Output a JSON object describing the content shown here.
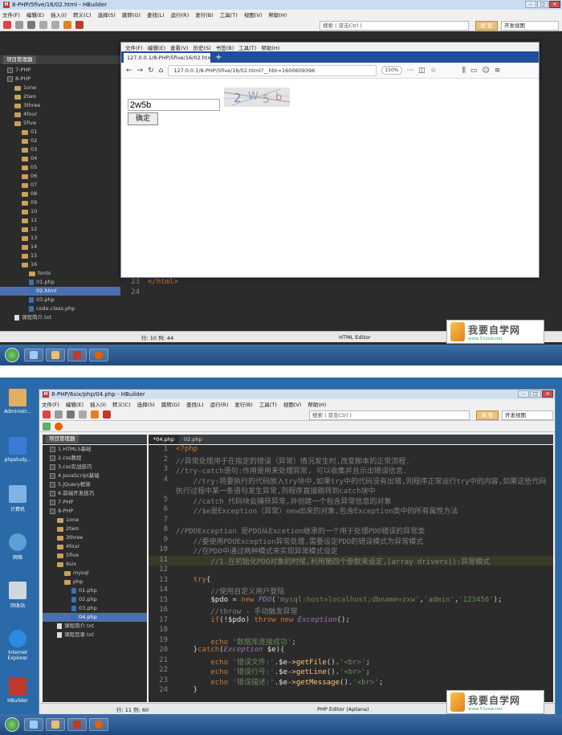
{
  "shot1": {
    "title": "8-PHP/5five/16/02.html - HBuilder",
    "menu": [
      "文件(F)",
      "编辑(E)",
      "插入(I)",
      "转义(C)",
      "选择(S)",
      "跳转(G)",
      "查找(L)",
      "运行(R)",
      "发行(B)",
      "工具(T)",
      "视图(V)",
      "帮助(H)"
    ],
    "search_placeholder": "搜索 ( 双击Ctrl )",
    "vip_label": "闻 智",
    "view_label": "开发视图",
    "panel_title": "项目管理器",
    "tree": [
      {
        "label": "7-PHP",
        "icon": "w",
        "indent": 1
      },
      {
        "label": "8-PHP",
        "icon": "w",
        "indent": 1
      },
      {
        "label": "1one",
        "icon": "folder",
        "indent": 2
      },
      {
        "label": "2two",
        "icon": "folder",
        "indent": 2
      },
      {
        "label": "3three",
        "icon": "folder",
        "indent": 2
      },
      {
        "label": "4four",
        "icon": "folder",
        "indent": 2
      },
      {
        "label": "5five",
        "icon": "folder",
        "indent": 2
      },
      {
        "label": "01",
        "icon": "folder",
        "indent": 3
      },
      {
        "label": "02",
        "icon": "folder",
        "indent": 3
      },
      {
        "label": "03",
        "icon": "folder",
        "indent": 3
      },
      {
        "label": "04",
        "icon": "folder",
        "indent": 3
      },
      {
        "label": "05",
        "icon": "folder",
        "indent": 3
      },
      {
        "label": "06",
        "icon": "folder",
        "indent": 3
      },
      {
        "label": "07",
        "icon": "folder",
        "indent": 3
      },
      {
        "label": "08",
        "icon": "folder",
        "indent": 3
      },
      {
        "label": "09",
        "icon": "folder",
        "indent": 3
      },
      {
        "label": "10",
        "icon": "folder",
        "indent": 3
      },
      {
        "label": "11",
        "icon": "folder",
        "indent": 3
      },
      {
        "label": "12",
        "icon": "folder",
        "indent": 3
      },
      {
        "label": "13",
        "icon": "folder",
        "indent": 3
      },
      {
        "label": "14",
        "icon": "folder",
        "indent": 3
      },
      {
        "label": "15",
        "icon": "folder",
        "indent": 3
      },
      {
        "label": "16",
        "icon": "folder",
        "indent": 3
      },
      {
        "label": "fonts",
        "icon": "folder",
        "indent": 4
      },
      {
        "label": "01.php",
        "icon": "file",
        "indent": 4
      },
      {
        "label": "02.html",
        "icon": "file",
        "indent": 4,
        "selected": true
      },
      {
        "label": "03.php",
        "icon": "file",
        "indent": 4
      },
      {
        "label": "code.class.php",
        "icon": "file",
        "indent": 4
      },
      {
        "label": "课程简介.txt",
        "icon": "txt",
        "indent": 2
      }
    ],
    "code_lines": [
      {
        "num": "23",
        "html": "</html>"
      },
      {
        "num": "24",
        "html": ""
      }
    ],
    "status_pos": "行: 10 列: 44",
    "status_mode": "HTML Editor",
    "browser": {
      "menu": [
        "文件(F)",
        "编辑(E)",
        "查看(V)",
        "历史(S)",
        "书签(B)",
        "工具(T)",
        "帮助(H)"
      ],
      "tab_title": "127.0.0.1/8-PHP/5five/16/02.htm",
      "url": "127.0.0.1/8-PHP/5five/16/02.html?__hbt=1600609396",
      "zoom": "150%",
      "input_value": "2w5b",
      "captcha": "2w5b",
      "submit_label": "确定"
    },
    "watermark_title": "我要自学网",
    "watermark_url": "www.51zxw.net"
  },
  "shot2": {
    "title": "8-PHP/6six/php/04.php - HBuilder",
    "menu": [
      "文件(F)",
      "编辑(E)",
      "插入(I)",
      "转义(C)",
      "选择(S)",
      "跳转(G)",
      "查找(L)",
      "运行(R)",
      "发行(B)",
      "工具(T)",
      "视图(V)",
      "帮助(H)"
    ],
    "search_placeholder": "搜索 ( 双击Ctrl )",
    "vip_label": "闻 智",
    "view_label": "开发视图",
    "panel_title": "项目管理器",
    "editor_tabs": [
      "*04.php",
      "02.php"
    ],
    "desktop_icons": [
      "Administr...",
      "phpstudy...",
      "计算机",
      "网络",
      "回收站",
      "Internet Explorer",
      "HBuilder"
    ],
    "tree": [
      {
        "label": "1.HTML5基础",
        "icon": "w",
        "indent": 1
      },
      {
        "label": "2.css教程",
        "icon": "w",
        "indent": 1
      },
      {
        "label": "3.css实战技巧",
        "icon": "w",
        "indent": 1
      },
      {
        "label": "4.JavaScript基础",
        "icon": "w",
        "indent": 1
      },
      {
        "label": "5.jQuery框架",
        "icon": "w",
        "indent": 1
      },
      {
        "label": "6.前端开发技巧",
        "icon": "w",
        "indent": 1
      },
      {
        "label": "7-PHP",
        "icon": "w",
        "indent": 1
      },
      {
        "label": "8-PHP",
        "icon": "w",
        "indent": 1
      },
      {
        "label": "1one",
        "icon": "folder",
        "indent": 2
      },
      {
        "label": "2two",
        "icon": "folder",
        "indent": 2
      },
      {
        "label": "3three",
        "icon": "folder",
        "indent": 2
      },
      {
        "label": "4four",
        "icon": "folder",
        "indent": 2
      },
      {
        "label": "5five",
        "icon": "folder",
        "indent": 2
      },
      {
        "label": "6six",
        "icon": "folder",
        "indent": 2
      },
      {
        "label": "mysql",
        "icon": "folder",
        "indent": 3
      },
      {
        "label": "php",
        "icon": "folder",
        "indent": 3
      },
      {
        "label": "01.php",
        "icon": "file",
        "indent": 4
      },
      {
        "label": "02.php",
        "icon": "file",
        "indent": 4
      },
      {
        "label": "03.php",
        "icon": "file",
        "indent": 4
      },
      {
        "label": "04.php",
        "icon": "file",
        "indent": 4,
        "selected": true
      },
      {
        "label": "课程简介.txt",
        "icon": "txt",
        "indent": 2
      },
      {
        "label": "课程目录.txt",
        "icon": "txt",
        "indent": 2
      }
    ],
    "code_lines": [
      {
        "num": "1",
        "html": "<span class='k'>&lt;?php</span>"
      },
      {
        "num": "2",
        "html": "<span class='c'>//异常处理用于在指定的错误（异常）情况发生时,改变脚本的正常流程.</span>"
      },
      {
        "num": "3",
        "html": "<span class='c'>//try-catch语句:作用是用来处理异常, 可以收集并且示出错误信息.</span>"
      },
      {
        "num": "4",
        "html": "<span class='c'>    //try:将要执行的代码放入try块中,如果try中的代码没有出错,则程序正常运行try中的内容,如果这些代码</span>"
      },
      {
        "num": "",
        "html": "<span class='c'>执行过程中某一条语句发生异常,则程序直接跳转到catch块中</span>"
      },
      {
        "num": "5",
        "html": "<span class='c'>    //catch 代码块会捕获异常,并创建一个包含异常信息的对象</span>"
      },
      {
        "num": "6",
        "html": "<span class='c'>    //$e是Exception（异常）new出来的对象,包含Exception类中的所有属性方法</span>"
      },
      {
        "num": "7",
        "html": ""
      },
      {
        "num": "8",
        "html": "<span class='c'>//PDOException 是PDO从Excetion继承的一个用于处理PDO错误的异常类</span>"
      },
      {
        "num": "9",
        "html": "<span class='c'>    //要使用PDOException异常处理,需要设定PDO的错误模式为异常模式</span>"
      },
      {
        "num": "10",
        "html": "<span class='c'>    //在PDO中通过两种模式来实现异常模式设定</span>"
      },
      {
        "num": "11",
        "html": "<span class='c'>        //1.在初始化PDO对象的时候,利用第四个参数来设定,[array drivers]):异常模式</span>"
      },
      {
        "num": "12",
        "html": ""
      },
      {
        "num": "13",
        "html": "    <span class='k'>try</span>{"
      },
      {
        "num": "14",
        "html": "        <span class='c'>//使用自定义用户登陆</span>"
      },
      {
        "num": "15",
        "html": "        <span class='v'>$pdo</span> = <span class='k'>new</span> <span class='it'>PDO</span>(<span class='s'>'mysql:host=localhost;dbname=zxw'</span>,<span class='s'>'admin'</span>,<span class='s'>'123456'</span>);"
      },
      {
        "num": "16",
        "html": "        <span class='c'>//throw - 手动触发异常</span>"
      },
      {
        "num": "17",
        "html": "        <span class='k'>if</span>(!<span class='v'>$pdo</span>) <span class='k'>throw</span> <span class='k'>new</span> <span class='it'>Exception</span>();"
      },
      {
        "num": "18",
        "html": ""
      },
      {
        "num": "19",
        "html": "        <span class='k'>echo</span> <span class='s'>'数据库连接成功'</span>;"
      },
      {
        "num": "20",
        "html": "    }<span class='k'>catch</span>(<span class='it'>Exception</span> <span class='v'>$e</span>){"
      },
      {
        "num": "21",
        "html": "        <span class='k'>echo</span> <span class='s'>'错误文件:'</span>.<span class='v'>$e</span>-&gt;<span class='f'>getFile</span>().<span class='s'>'&lt;br&gt;'</span>;"
      },
      {
        "num": "22",
        "html": "        <span class='k'>echo</span> <span class='s'>'错误行号:'</span>.<span class='v'>$e</span>-&gt;<span class='f'>getLine</span>().<span class='s'>'&lt;br&gt;'</span>;"
      },
      {
        "num": "23",
        "html": "        <span class='k'>echo</span> <span class='s'>'错误描述:'</span>.<span class='v'>$e</span>-&gt;<span class='f'>getMessage</span>().<span class='s'>'&lt;br&gt;'</span>;"
      },
      {
        "num": "24",
        "html": "    }"
      }
    ],
    "status_pos": "行: 11 列: 60",
    "status_mode": "PHP Editor (Aptana)",
    "watermark_title": "我要自学网",
    "watermark_url": "www.51zxw.net"
  }
}
